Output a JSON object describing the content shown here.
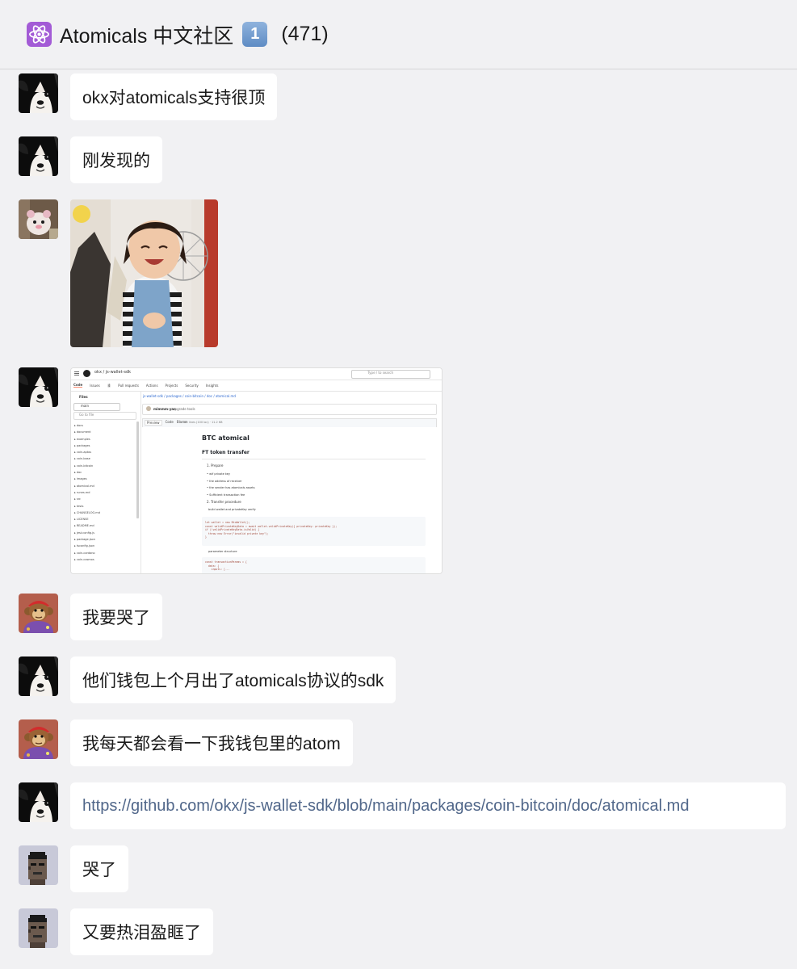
{
  "header": {
    "icon": "atom-icon",
    "title": "Atomicals 中文社区",
    "badge": "1",
    "count": "(471)"
  },
  "messages": [
    {
      "avatar": "dog-avatar",
      "text": "okx对atomicals支持很顶"
    },
    {
      "avatar": "dog-avatar",
      "text": "刚发现的"
    },
    {
      "avatar": "plush-avatar",
      "type": "image",
      "image": "toddler-sticker"
    },
    {
      "avatar": "dog-avatar",
      "type": "image",
      "image": "github-screenshot"
    },
    {
      "avatar": "monkey-avatar",
      "text": "我要哭了"
    },
    {
      "avatar": "dog-avatar",
      "text": "他们钱包上个月出了atomicals协议的sdk"
    },
    {
      "avatar": "monkey-avatar",
      "text": "我每天都会看一下我钱包里的atom"
    },
    {
      "avatar": "dog-avatar",
      "text": "https://github.com/okx/js-wallet-sdk/blob/main/packages/coin-bitcoin/doc/atomical.md",
      "link": true
    },
    {
      "avatar": "punk-avatar",
      "text": "哭了"
    },
    {
      "avatar": "punk-avatar",
      "text": "又要热泪盈眶了"
    }
  ],
  "screenshot": {
    "repo": "okx / js-wallet-sdk",
    "path": "js-wallet-sdk / packages / coin-bitcoin / doc / atomical.md",
    "heading": "BTC atomical",
    "subheading": "FT token transfer",
    "search": "Type / to search",
    "branch": "main",
    "files_label": "Files",
    "file_search": "Go to file",
    "commit_author": "mimmm-yan",
    "commit_msg": "upgrade tools",
    "file_tabs": [
      "Preview",
      "Code",
      "Blame"
    ],
    "file_meta": "105 lines (100 loc) · 11.2 KB",
    "steps": [
      "1. Prepare",
      "2. Transfer procedure"
    ],
    "prepare_items": [
      "wif private key",
      "the address of receiver",
      "the sender has atomicals assets",
      "Sufficient transaction fee"
    ],
    "procedure_items": [
      "build wallet and privateKey verify",
      "parameter structure"
    ],
    "code_lines": [
      "let wallet = new BtcWallet();",
      "const validPrivateKeyData = await wallet.validPrivateKey({ privateKey: privateKey });",
      "if (!validPrivateKeyData.isValid) {",
      "  throw new Error(\"invalid private key\");",
      "}"
    ],
    "code2_lines": [
      "const transactionParams = {",
      "  data: {",
      "    inputs: [..."
    ],
    "nav_tabs": [
      "Code",
      "Issues",
      "Pull requests",
      "Actions",
      "Projects",
      "Security",
      "Insights"
    ],
    "issues_count": "4",
    "tree_items": [
      "docs",
      "document",
      "examples",
      "packages",
      "coin-aptos",
      "coin-base",
      "coin-bitcoin",
      "doc",
      "images",
      "atomical.md",
      "runes.md",
      "src",
      "tests",
      "CHANGELOG.md",
      "LICENSE",
      "README.md",
      "jest.config.js",
      "package.json",
      "tsconfig.json",
      "coin-cardano",
      "coin-cosmos"
    ]
  }
}
